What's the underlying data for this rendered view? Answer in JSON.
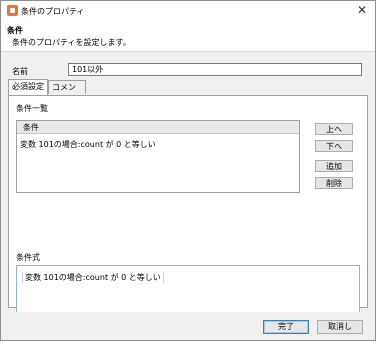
{
  "window": {
    "title": "条件のプロパティ",
    "close_glyph": "✕"
  },
  "header": {
    "title": "条件",
    "description": "条件のプロパティを設定します。"
  },
  "form": {
    "name_label": "名前",
    "name_value": "101以外"
  },
  "tabs": [
    {
      "label": "必須設定",
      "active": true
    },
    {
      "label": "コメント",
      "active": false
    }
  ],
  "conditions_list": {
    "label": "条件一覧",
    "column_header": "条件",
    "rows": [
      "変数 101の場合:count が 0 と等しい"
    ]
  },
  "list_buttons": {
    "up": "上へ",
    "down": "下へ",
    "add": "追加",
    "delete": "削除"
  },
  "expression": {
    "label": "条件式",
    "value": "変数 101の場合:count が 0 と等しい"
  },
  "footer": {
    "ok": "完了",
    "cancel": "取消し"
  },
  "colors": {
    "app_icon": "#e8762c",
    "expr_border": "#8fb3d9"
  }
}
